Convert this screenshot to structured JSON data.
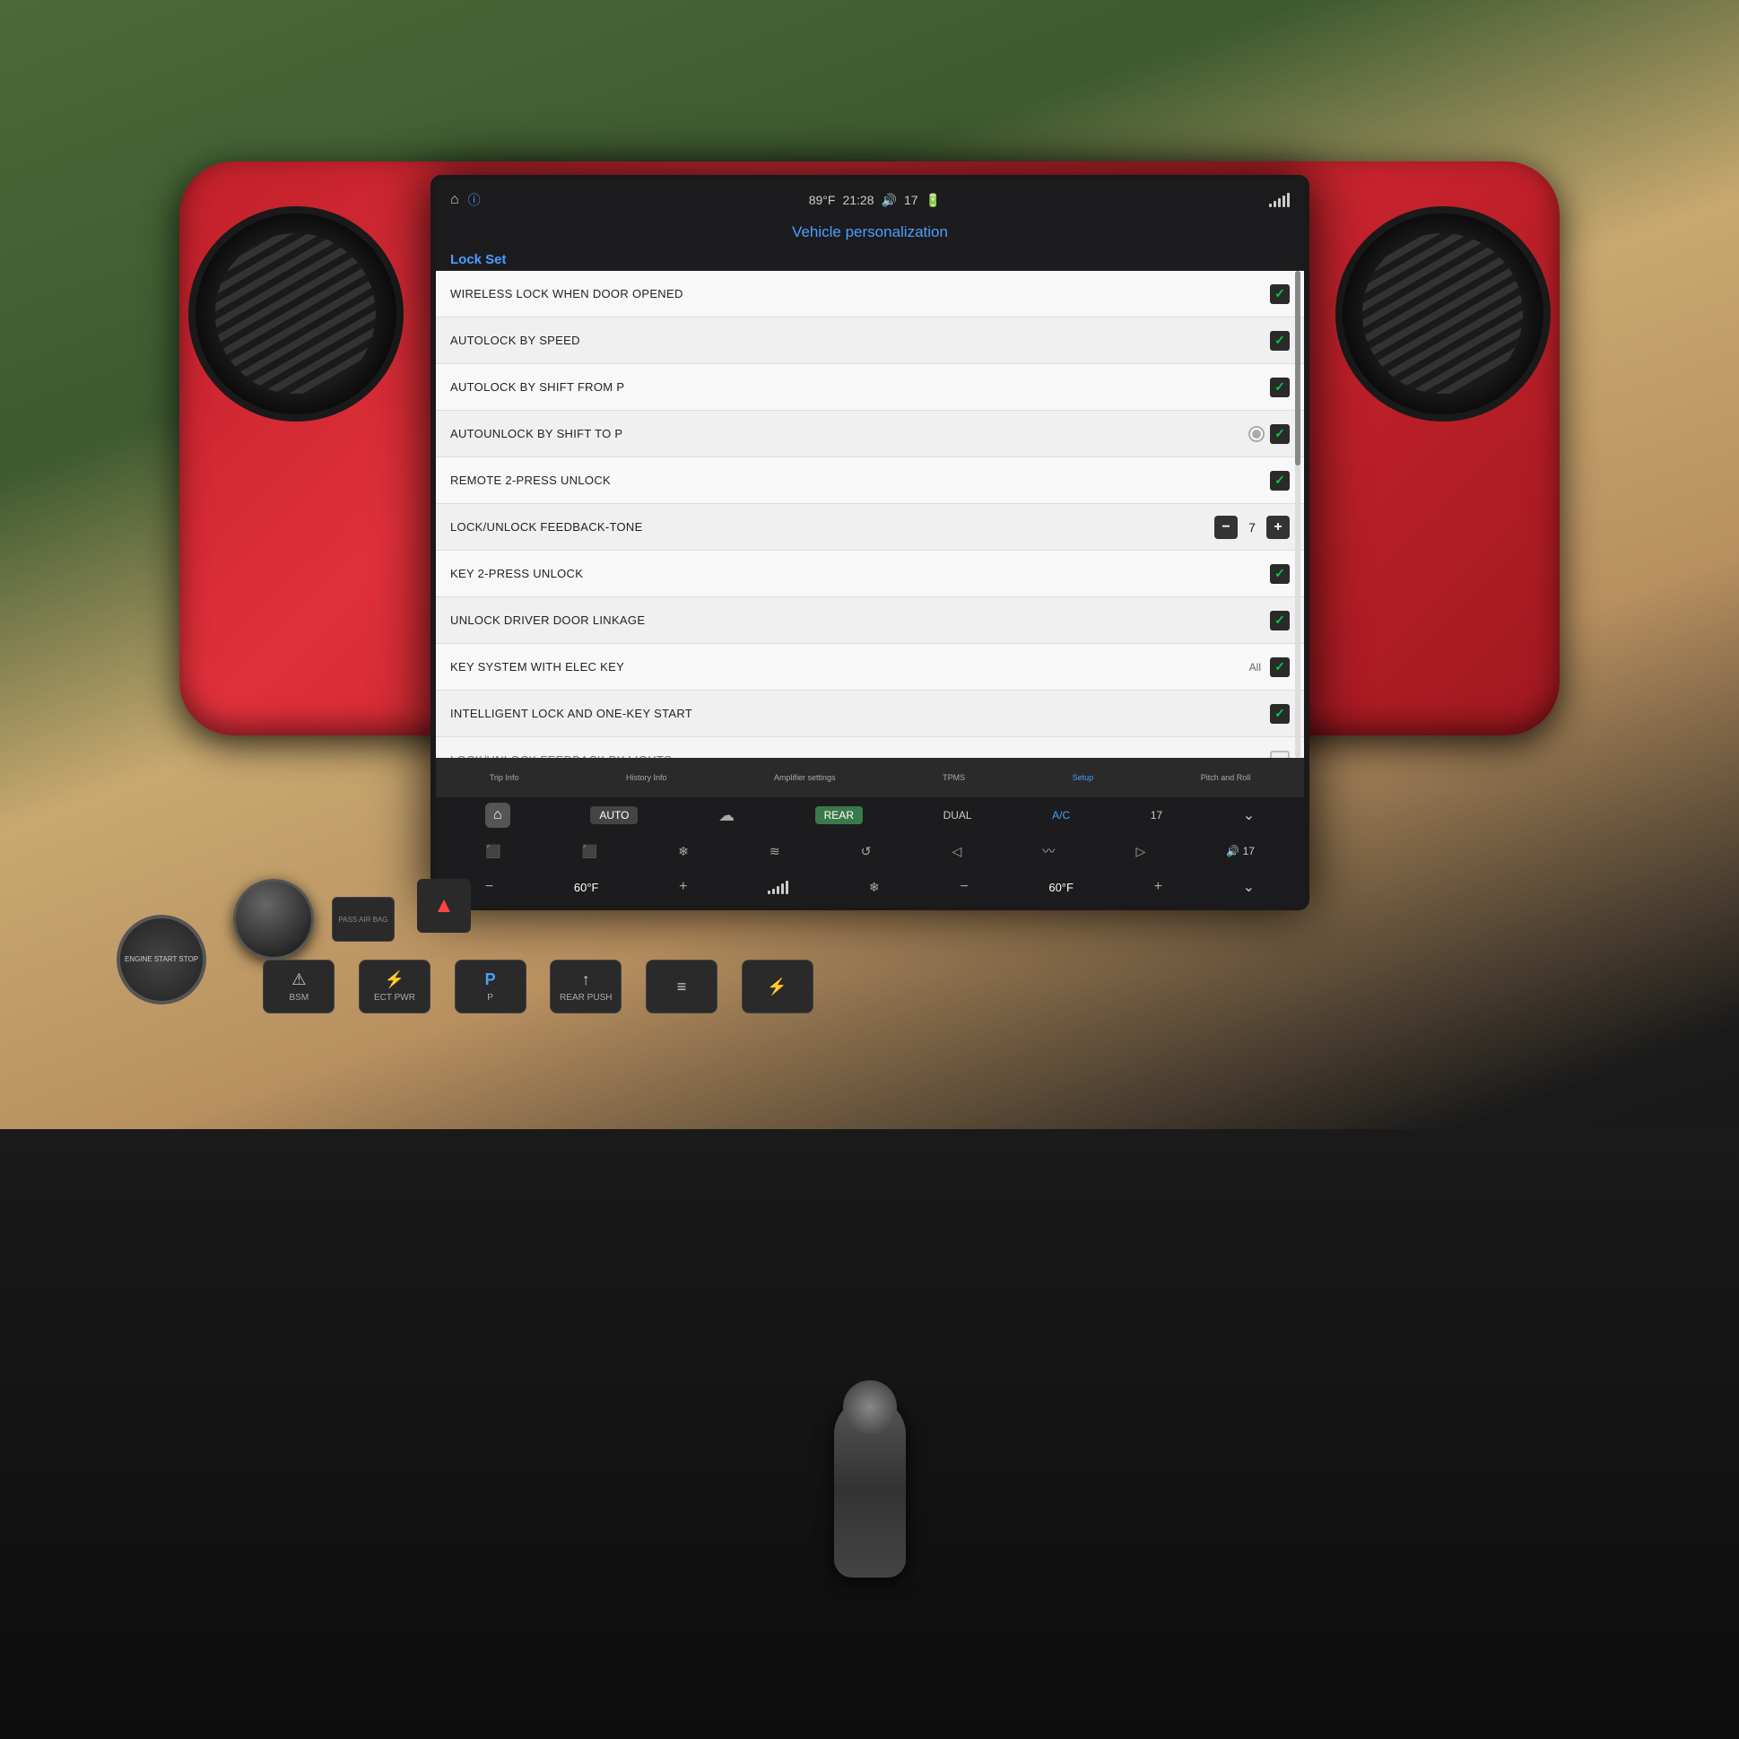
{
  "scene": {
    "bg_description": "Car interior Toyota Tacoma"
  },
  "screen": {
    "status_bar": {
      "home_icon": "⌂",
      "info_icon": "ⓘ",
      "temperature": "89°F",
      "time": "21:28",
      "volume_icon": "🔊",
      "signal": "17",
      "battery_icon": "🔋"
    },
    "title": "Vehicle personalization",
    "section_label": "Lock Set",
    "settings": [
      {
        "label": "Wireless lock when door opened",
        "control": "checkbox",
        "value": true
      },
      {
        "label": "AUTOLOCK BY SPEED",
        "control": "checkbox",
        "value": true
      },
      {
        "label": "AUTOLOCK BY SHIFT FROM P",
        "control": "checkbox",
        "value": true
      },
      {
        "label": "AUTOUNLOCK BY SHIFT TO P",
        "control": "radio_checkbox",
        "value": true
      },
      {
        "label": "REMOTE 2-PRESS UNLOCK",
        "control": "checkbox",
        "value": true
      },
      {
        "label": "LOCK/UNLOCK FEEDBACK-TONE",
        "control": "stepper",
        "value": 7
      },
      {
        "label": "KEY 2-PRESS UNLOCK",
        "control": "checkbox",
        "value": true
      },
      {
        "label": "UNLOCK DRIVER DOOR LINKAGE",
        "control": "checkbox",
        "value": true
      },
      {
        "label": "KEY SYSTEM WITH ELEC KEY",
        "control": "checkbox_all",
        "value": true,
        "extra": "All"
      },
      {
        "label": "INTELLIGENT LOCK AND ONE-KEY START",
        "control": "checkbox",
        "value": true
      },
      {
        "label": "LOCK/UNLOCK FEEDBACK BY LIGHTS",
        "control": "partial",
        "value": false
      }
    ],
    "bottom_nav": [
      {
        "label": "Trip Info",
        "active": false
      },
      {
        "label": "History Info",
        "active": false
      },
      {
        "label": "Amplifier settings",
        "active": false
      },
      {
        "label": "TPMS",
        "active": false
      },
      {
        "label": "Setup",
        "active": true
      },
      {
        "label": "Pitch and Roll",
        "active": false
      }
    ],
    "climate": {
      "auto_label": "AUTO",
      "rear_label": "REAR",
      "dual_label": "DUAL",
      "ac_label": "A/C",
      "temp_left": "60°F",
      "temp_right": "60°F",
      "fan_speed": "17"
    }
  },
  "controls": {
    "engine_start_label": "ENGINE\nSTART\nSTOP",
    "pass_airbag_label": "PASS\nAIR BAG",
    "warning_icon": "▲",
    "small_buttons": [
      {
        "label": "BSM",
        "icon": "⚠"
      },
      {
        "label": "ECT PWR",
        "icon": "⚡"
      },
      {
        "label": "P",
        "icon": "P"
      },
      {
        "label": "REAR PUSH",
        "icon": "↑"
      },
      {
        "label": "",
        "icon": "≡"
      },
      {
        "label": "",
        "icon": "⚡"
      }
    ]
  }
}
